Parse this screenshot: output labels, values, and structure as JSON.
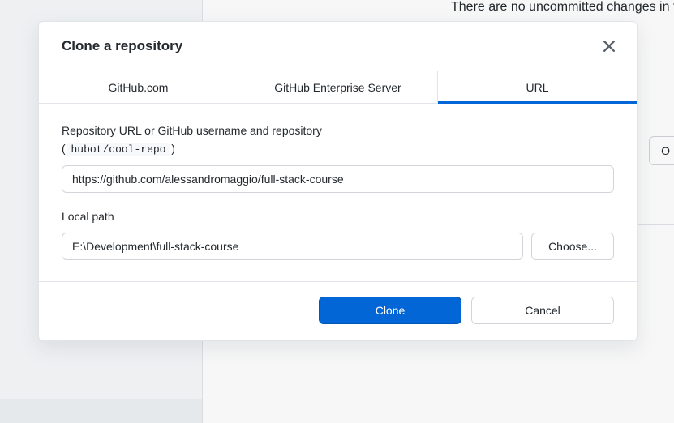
{
  "background": {
    "heading": "There are no uncommitted changes in this repository. Here are som",
    "button_label": "O"
  },
  "modal": {
    "title": "Clone a repository",
    "tabs": [
      {
        "label": "GitHub.com",
        "active": false
      },
      {
        "label": "GitHub Enterprise Server",
        "active": false
      },
      {
        "label": "URL",
        "active": true
      }
    ],
    "repo_url": {
      "label_main": "Repository URL or GitHub username and repository",
      "label_hint_open": "( ",
      "label_hint_code": "hubot/cool-repo",
      "label_hint_close": " )",
      "value": "https://github.com/alessandromaggio/full-stack-course"
    },
    "local_path": {
      "label": "Local path",
      "value": "E:\\Development\\full-stack-course",
      "choose_label": "Choose..."
    },
    "footer": {
      "clone_label": "Clone",
      "cancel_label": "Cancel"
    }
  }
}
